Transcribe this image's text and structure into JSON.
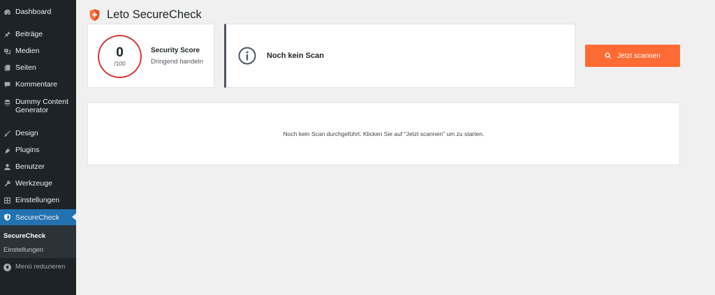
{
  "sidebar": {
    "items": [
      {
        "label": "Dashboard",
        "icon": "dashboard-icon"
      },
      {
        "label": "Beiträge",
        "icon": "pin-icon"
      },
      {
        "label": "Medien",
        "icon": "media-icon"
      },
      {
        "label": "Seiten",
        "icon": "pages-icon"
      },
      {
        "label": "Kommentare",
        "icon": "comments-icon"
      },
      {
        "label": "Dummy Content Generator",
        "icon": "database-icon"
      },
      {
        "label": "Design",
        "icon": "brush-icon"
      },
      {
        "label": "Plugins",
        "icon": "plugin-icon"
      },
      {
        "label": "Benutzer",
        "icon": "user-icon"
      },
      {
        "label": "Werkzeuge",
        "icon": "wrench-icon"
      },
      {
        "label": "Einstellungen",
        "icon": "settings-icon"
      },
      {
        "label": "SecureCheck",
        "icon": "shield-icon"
      }
    ],
    "submenu": [
      "SecureCheck",
      "Einstellungen"
    ],
    "collapse_label": "Menü reduzieren"
  },
  "header": {
    "title": "Leto SecureCheck",
    "logo": "shield-logo-icon",
    "accent": "#ff6b35"
  },
  "score": {
    "value": "0",
    "max": "/100",
    "label": "Security Score",
    "status": "Dringend handeln",
    "ring_color": "#d63638"
  },
  "scan_status": {
    "text": "Noch kein Scan",
    "icon": "info-icon"
  },
  "actions": {
    "scan_button": "Jetzt scannen",
    "scan_icon": "search-icon"
  },
  "empty_state": {
    "message": "Noch kein Scan durchgeführt. Klicken Sie auf \"Jetzt scannen\" um zu starten."
  }
}
